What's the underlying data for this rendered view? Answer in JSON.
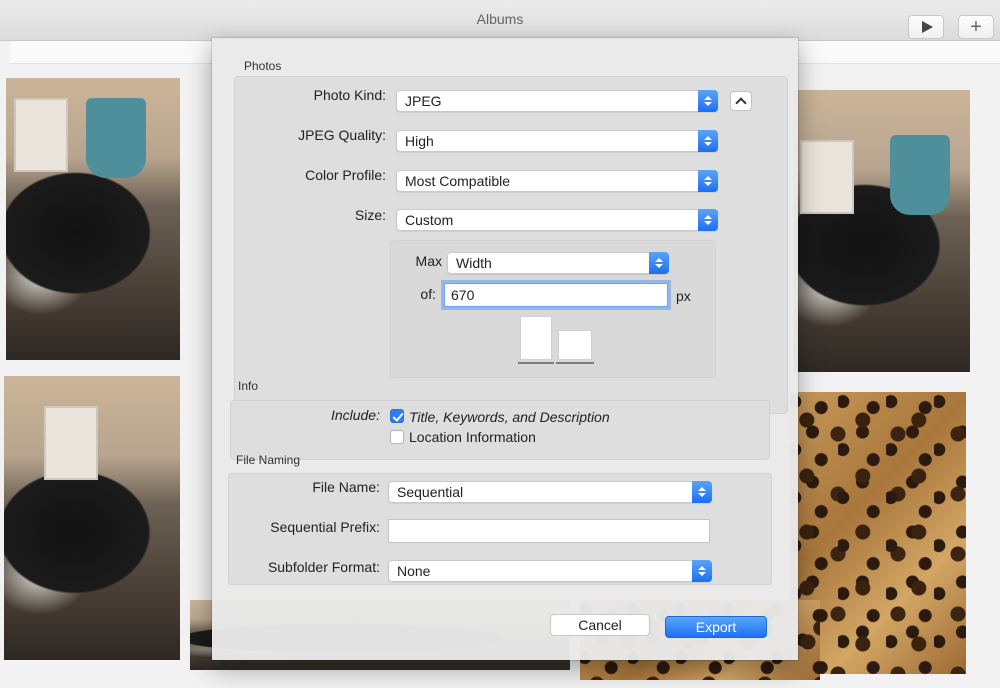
{
  "window": {
    "title": "Albums"
  },
  "toolbar": {
    "play_icon": "play-icon",
    "add_icon": "plus-icon"
  },
  "colors": {
    "accent": "#1e70f2",
    "sheet_bg": "#e9e9e9"
  },
  "sheet": {
    "photos": {
      "section_title": "Photos",
      "photo_kind": {
        "label": "Photo Kind:",
        "value": "JPEG"
      },
      "jpeg_quality": {
        "label": "JPEG Quality:",
        "value": "High"
      },
      "color_profile": {
        "label": "Color Profile:",
        "value": "Most Compatible"
      },
      "size": {
        "label": "Size:",
        "value": "Custom"
      },
      "custom_size": {
        "max_label": "Max",
        "max_value": "Width",
        "of_label": "of:",
        "of_value": "670",
        "unit": "px"
      }
    },
    "info": {
      "section_title": "Info",
      "include_label": "Include:",
      "title_keywords": {
        "label": "Title, Keywords, and Description",
        "checked": true
      },
      "location": {
        "label": "Location Information",
        "checked": false
      }
    },
    "file_naming": {
      "section_title": "File Naming",
      "file_name": {
        "label": "File Name:",
        "value": "Sequential"
      },
      "sequential_prefix": {
        "label": "Sequential Prefix:",
        "value": ""
      },
      "subfolder_format": {
        "label": "Subfolder Format:",
        "value": "None"
      }
    },
    "buttons": {
      "cancel": "Cancel",
      "export": "Export"
    }
  }
}
